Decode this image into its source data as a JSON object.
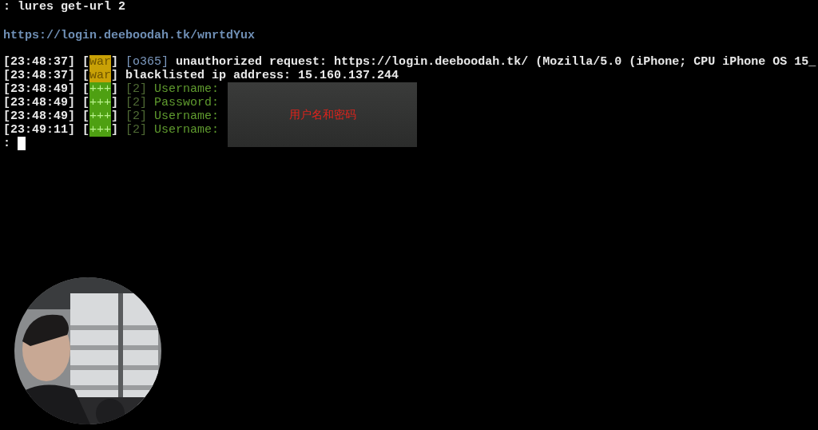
{
  "terminal": {
    "command": {
      "prompt": ":",
      "text": "lures get-url 2"
    },
    "url": "https://login.deeboodah.tk/wnrtdYux",
    "log": [
      {
        "time": "[23:48:37]",
        "tag": {
          "open": "[",
          "text": "war",
          "close": "]",
          "kind": "warning"
        },
        "module": "[o365]",
        "message": "unauthorized request: https://login.deeboodah.tk/ (Mozilla/5.0 (iPhone; CPU iPhone OS 15_"
      },
      {
        "time": "[23:48:37]",
        "tag": {
          "open": "[",
          "text": "war",
          "close": "]",
          "kind": "warning"
        },
        "message": "blacklisted ip address: 15.160.137.244"
      },
      {
        "time": "[23:48:49]",
        "tag": {
          "open": "[",
          "text": "+++",
          "close": "]",
          "kind": "success"
        },
        "session": "[2]",
        "message": "Username:"
      },
      {
        "time": "[23:48:49]",
        "tag": {
          "open": "[",
          "text": "+++",
          "close": "]",
          "kind": "success"
        },
        "session": "[2]",
        "message": "Password:"
      },
      {
        "time": "[23:48:49]",
        "tag": {
          "open": "[",
          "text": "+++",
          "close": "]",
          "kind": "success"
        },
        "session": "[2]",
        "message": "Username:"
      },
      {
        "time": "[23:49:11]",
        "tag": {
          "open": "[",
          "text": "+++",
          "close": "]",
          "kind": "success"
        },
        "session": "[2]",
        "message": "Username:"
      }
    ],
    "input": {
      "prompt": ":",
      "cursor_visible": true
    }
  },
  "overlay": {
    "caption": "用户名和密码"
  }
}
